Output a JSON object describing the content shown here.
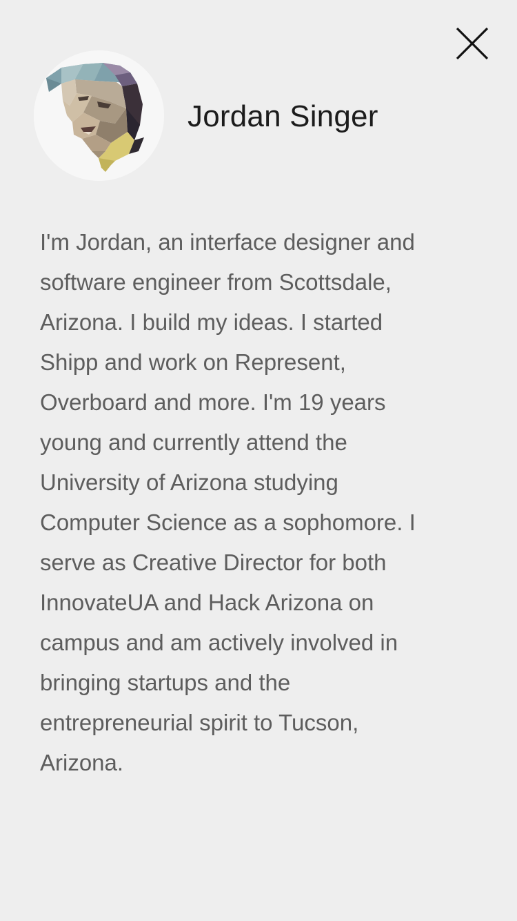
{
  "profile": {
    "name": "Jordan Singer",
    "bio_lines": [
      "I'm Jordan, an interface designer and",
      "software engineer from Scottsdale,",
      "Arizona. I build my ideas. I started",
      "Shipp and work on Represent,",
      "Overboard and more. I'm 19 years",
      "young and currently attend the",
      "University of Arizona studying",
      "Computer Science as a sophomore. I",
      "serve as Creative Director for both",
      "InnovateUA and Hack Arizona on",
      "campus and am actively involved in",
      "bringing startups and the",
      "entrepreneurial spirit to Tucson,",
      "Arizona."
    ]
  },
  "icons": {
    "close": "close-icon",
    "avatar": "low-poly-portrait"
  },
  "colors": {
    "background": "#eeeeee",
    "name_text": "#1c1c1c",
    "bio_text": "#5d5d5d"
  }
}
